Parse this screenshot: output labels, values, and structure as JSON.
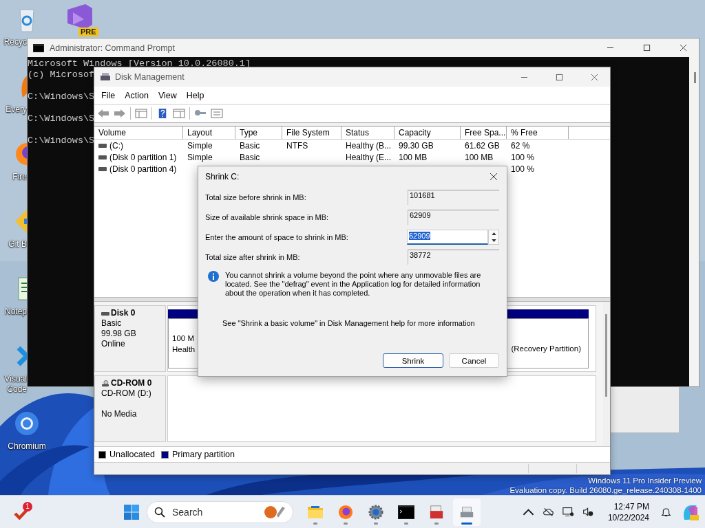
{
  "desktop": {
    "icons": [
      {
        "kind": "recycle",
        "lines": [
          "Recyc"
        ]
      },
      {
        "kind": "everything",
        "lines": [
          "Every"
        ]
      },
      {
        "kind": "firefox",
        "lines": [
          "Fire"
        ]
      },
      {
        "kind": "git",
        "lines": [
          "Git B"
        ]
      },
      {
        "kind": "notepad",
        "lines": [
          "Notep"
        ]
      },
      {
        "kind": "vscode",
        "lines": [
          "Visual",
          "Code"
        ]
      },
      {
        "kind": "chromium",
        "lines": [
          "Chromium"
        ]
      }
    ],
    "pinned_icon": {
      "badge": "PRE"
    },
    "watermark": [
      "Windows 11 Pro Insider Preview",
      "Evaluation copy. Build 26080.ge_release.240308-1400"
    ]
  },
  "cmd_window": {
    "title": "Administrator: Command Prompt",
    "lines": [
      "Microsoft Windows [Version 10.0.26080.1]",
      "(c) Microsof",
      "C:\\Windows\\S",
      "C:\\Windows\\S",
      "C:\\Windows\\S"
    ]
  },
  "disk_window": {
    "title": "Disk Management",
    "menu": [
      "File",
      "Action",
      "View",
      "Help"
    ],
    "table": {
      "columns": [
        "Volume",
        "Layout",
        "Type",
        "File System",
        "Status",
        "Capacity",
        "Free Spa...",
        "% Free"
      ],
      "rows": [
        [
          "(C:)",
          "Simple",
          "Basic",
          "NTFS",
          "Healthy (B...",
          "99.30 GB",
          "61.62 GB",
          "62 %"
        ],
        [
          "(Disk 0 partition 1)",
          "Simple",
          "Basic",
          "",
          "Healthy (E...",
          "100 MB",
          "100 MB",
          "100 %"
        ],
        [
          "(Disk 0 partition 4)",
          "",
          "",
          "",
          "",
          "",
          "",
          "100 %"
        ]
      ]
    },
    "disks": [
      {
        "kind": "disk",
        "name": "Disk 0",
        "info": [
          "Basic",
          "99.98 GB"
        ],
        "status": "Online",
        "partitions": [
          {
            "lines": [
              "100 M",
              "Health"
            ]
          },
          {
            "lines": [
              "(Recovery Partition)"
            ]
          }
        ]
      },
      {
        "kind": "cdrom",
        "name": "CD-ROM 0",
        "info": [
          "CD-ROM (D:)"
        ],
        "status": "No Media"
      }
    ],
    "legend": [
      {
        "label": "Unallocated",
        "color": "#000000"
      },
      {
        "label": "Primary partition",
        "color": "#000080"
      }
    ]
  },
  "dialog": {
    "title": "Shrink C:",
    "fields": [
      {
        "kind": "readonly",
        "label": "Total size before shrink in MB:",
        "value": "101681"
      },
      {
        "kind": "readonly",
        "label": "Size of available shrink space in MB:",
        "value": "62909"
      },
      {
        "kind": "spin",
        "label": "Enter the amount of space to shrink in MB:",
        "value": "62909",
        "text_selected": true
      },
      {
        "kind": "readonly",
        "label": "Total size after shrink in MB:",
        "value": "38772"
      }
    ],
    "info": "You cannot shrink a volume beyond the point where any unmovable files are located. See the \"defrag\" event in the Application log for detailed information about the operation when it has completed.",
    "help": "See \"Shrink a basic volume\" in Disk Management help for more information",
    "buttons": [
      {
        "label": "Shrink",
        "default": true
      },
      {
        "label": "Cancel",
        "default": false
      }
    ]
  },
  "taskbar": {
    "search": {
      "placeholder": "Search"
    },
    "notification_count": "1",
    "apps": [
      {
        "kind": "explorer",
        "selected": false
      },
      {
        "kind": "firefox",
        "selected": false
      },
      {
        "kind": "settings",
        "selected": false
      },
      {
        "kind": "terminal",
        "selected": false
      },
      {
        "kind": "toolbox",
        "selected": false
      },
      {
        "kind": "diskmgmt",
        "selected": true
      }
    ],
    "time": "12:47 PM",
    "date": "10/22/2024"
  }
}
